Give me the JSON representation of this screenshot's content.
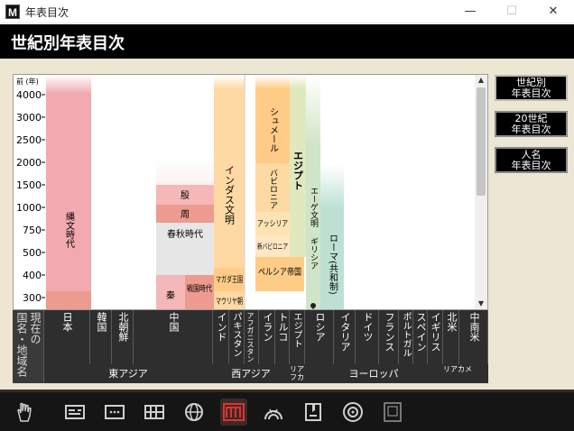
{
  "window": {
    "title": "年表目次",
    "app_icon": "M",
    "minimize": "—",
    "maximize": "☐",
    "close": "✕"
  },
  "header": {
    "title": "世紀別年表目次"
  },
  "side_buttons": [
    {
      "line1": "世紀別",
      "line2": "年表目次",
      "selected": true
    },
    {
      "line1": "20世紀",
      "line2": "年表目次",
      "selected": false
    },
    {
      "line1": "人名",
      "line2": "年表目次",
      "selected": false
    }
  ],
  "axis": {
    "unit": "前 (年)",
    "ticks": [
      "4000",
      "3000",
      "2500",
      "2000",
      "1500",
      "1000",
      "750",
      "500",
      "400",
      "300"
    ]
  },
  "eras": [
    {
      "text": "縄文時代",
      "id": "jomon"
    },
    {
      "text": "殷",
      "id": "yin"
    },
    {
      "text": "周",
      "id": "zhou"
    },
    {
      "text": "春秋時代",
      "id": "chunqiu"
    },
    {
      "text": "秦",
      "id": "qin"
    },
    {
      "text": "戦国時代",
      "id": "sengoku"
    },
    {
      "text": "インダス文明",
      "id": "indus"
    },
    {
      "text": "マガダ王国",
      "id": "magadha"
    },
    {
      "text": "マウリヤ朝",
      "id": "maurya"
    },
    {
      "text": "シュメール",
      "id": "sumer"
    },
    {
      "text": "バビロニア",
      "id": "babylonia"
    },
    {
      "text": "アッシリア",
      "id": "assyria"
    },
    {
      "text": "新バビロニア",
      "id": "neobabylonia"
    },
    {
      "text": "ペルシア帝国",
      "id": "persia"
    },
    {
      "text": "エジプト",
      "id": "egypt"
    },
    {
      "text": "エーゲ文明",
      "id": "aegean"
    },
    {
      "text": "ギリシア",
      "id": "greece"
    },
    {
      "text": "ローマ(共和制)",
      "id": "rome"
    }
  ],
  "row_label": [
    "現在の",
    "国名・地域名"
  ],
  "countries": [
    "日本",
    "韓国",
    "北朝鮮",
    "中国",
    "インド",
    "パキスタン",
    "アフガニスタン",
    "イラン",
    "トルコ",
    "エジプト",
    "ロシア",
    "イタリア",
    "ドイツ",
    "フランス",
    "ポルトガル",
    "スペイン",
    "イギリス",
    "北米",
    "中南米"
  ],
  "regions": [
    {
      "label": "東アジア",
      "color": "#a00000"
    },
    {
      "label": "西アジア",
      "color": "#6e3b06"
    },
    {
      "label": "リアフカ",
      "color": "#8a6a00"
    },
    {
      "label": "ヨーロッパ",
      "color": "#1f6065"
    },
    {
      "label": "リアカメ",
      "color": "#1c5fa3"
    }
  ],
  "toolbar": [
    {
      "icon": "hand-pointer-icon",
      "active": false
    },
    {
      "icon": "card-icon",
      "active": false
    },
    {
      "icon": "dots-icon",
      "active": false
    },
    {
      "icon": "table-icon",
      "active": false
    },
    {
      "icon": "globe-icon",
      "active": false
    },
    {
      "icon": "timeline-icon",
      "active": true
    },
    {
      "icon": "arch-icon",
      "active": false
    },
    {
      "icon": "bookmark-icon",
      "active": false
    },
    {
      "icon": "disc-icon",
      "active": false
    },
    {
      "icon": "frame-icon",
      "active": false
    }
  ],
  "colors": {
    "japan": "#f2a9b0",
    "china": "#f4b8b8",
    "china_dark": "#ec9b8e",
    "china_gray": "#e6e6e6",
    "india": "#ffd9a3",
    "west_asia": "#ffcc88",
    "egypt": "#d9e6b8",
    "greece": "#c8e0c4",
    "rome": "#b9ddd0"
  }
}
